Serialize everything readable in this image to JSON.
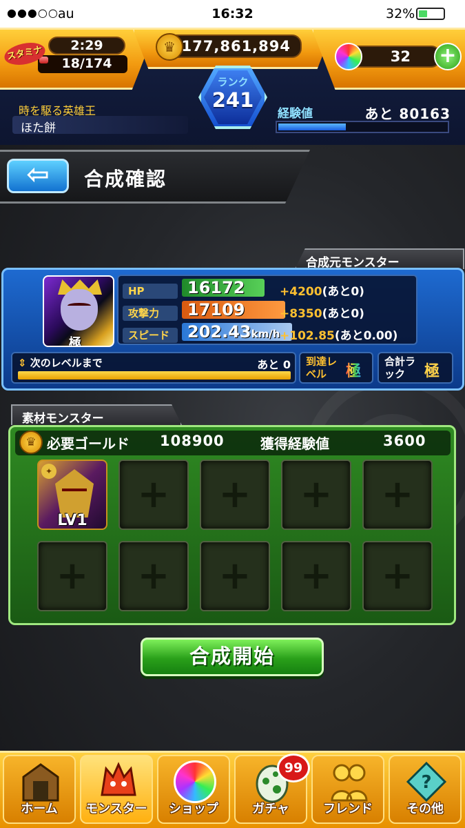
{
  "status_bar": {
    "signal": "●●●○○",
    "carrier": "au",
    "time": "16:32",
    "battery": "32%"
  },
  "header": {
    "stamina_label": "スタミナ",
    "stamina_timer": "2:29",
    "stamina_value": "18/174",
    "stamina_fill": 0.1,
    "gold": "177,861,894",
    "gems": "32",
    "rank_label": "ランク",
    "rank": "241",
    "player_title": "時を駆る英雄王",
    "player_name": "ほた餅",
    "exp_label": "経験値",
    "exp_remaining": "あと 80163",
    "exp_fill": 0.4
  },
  "page": {
    "title": "合成確認"
  },
  "base_monster": {
    "tab_label": "合成元モンスター",
    "badge": "極",
    "hp_label": "HP",
    "hp": "16172",
    "hp_plus": "+4200",
    "hp_rest": "(あと0)",
    "atk_label": "攻撃力",
    "atk": "17109",
    "atk_plus": "+8350",
    "atk_rest": "(あと0)",
    "spd_label": "スピード",
    "spd": "202.43",
    "spd_unit": "km/h",
    "spd_plus": "+102.85",
    "spd_rest": "(あと0.00)",
    "next_level_label": "次のレベルまで",
    "next_level_value": "あと 0",
    "reach_label": "到達レベル",
    "reach_value": "極",
    "luck_label": "合計ラック",
    "luck_value": "極"
  },
  "material": {
    "tab_label": "素材モンスター",
    "required_gold_label": "必要ゴールド",
    "required_gold": "108900",
    "gain_exp_label": "獲得経験値",
    "gain_exp": "3600",
    "first_slot_level": "LV1",
    "empty_slot_symbol": "+"
  },
  "start_button": "合成開始",
  "nav": {
    "home": "ホーム",
    "monster": "モンスター",
    "shop": "ショップ",
    "gacha": "ガチャ",
    "gacha_badge": "99",
    "friend": "フレンド",
    "other": "その他"
  },
  "colors": {
    "accent_orange": "#f29a10",
    "panel_blue": "#1e6ad0",
    "panel_green": "#2f8a22",
    "start_green": "#2aa01a"
  }
}
